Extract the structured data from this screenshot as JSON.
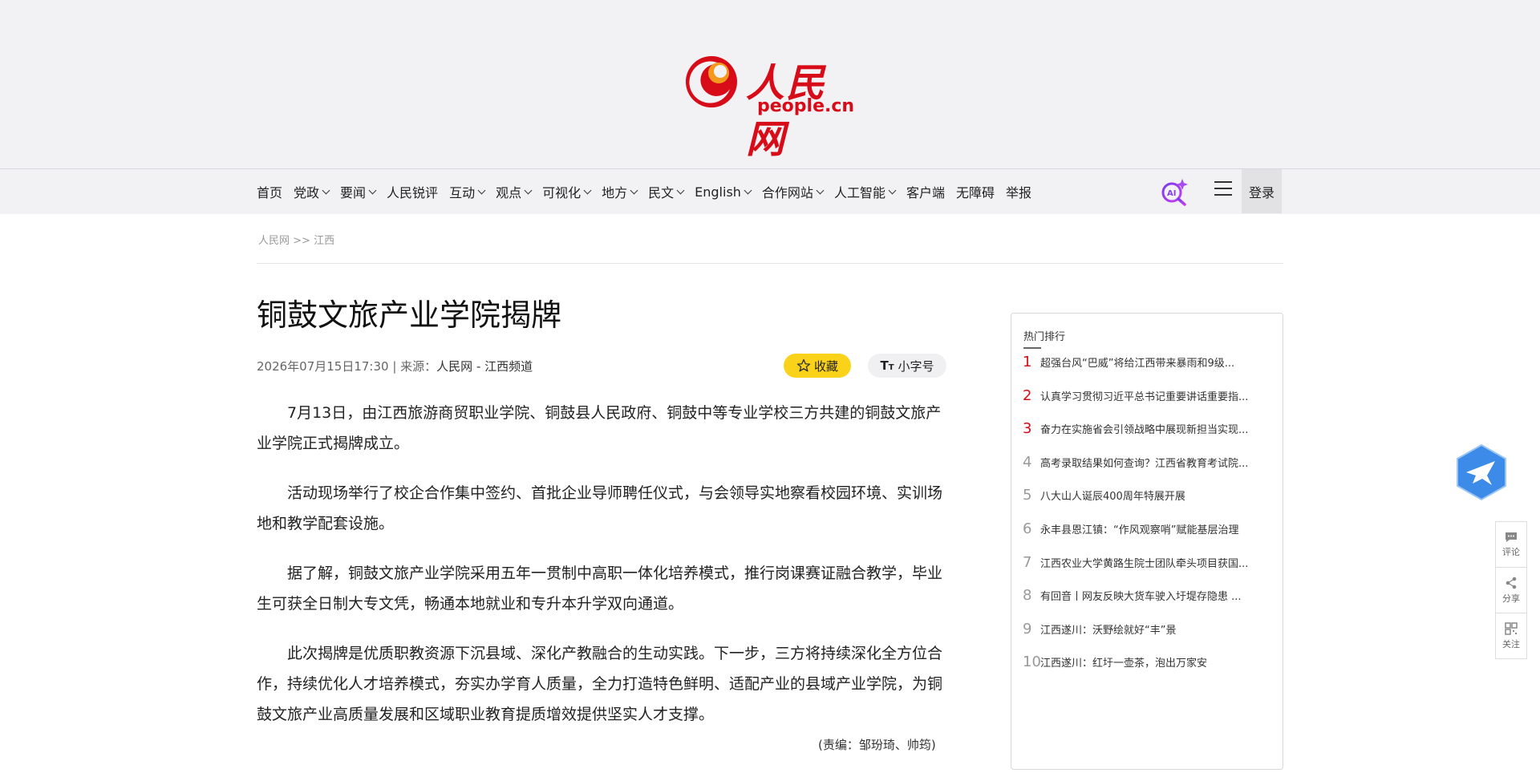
{
  "logo": {
    "cn": "人民网",
    "en": "people.cn"
  },
  "nav": {
    "items": [
      {
        "label": "首页",
        "dropdown": false
      },
      {
        "label": "党政",
        "dropdown": true
      },
      {
        "label": "要闻",
        "dropdown": true
      },
      {
        "label": "人民锐评",
        "dropdown": false
      },
      {
        "label": "互动",
        "dropdown": true
      },
      {
        "label": "观点",
        "dropdown": true
      },
      {
        "label": "可视化",
        "dropdown": true
      },
      {
        "label": "地方",
        "dropdown": true
      },
      {
        "label": "民文",
        "dropdown": true
      },
      {
        "label": "English",
        "dropdown": true
      },
      {
        "label": "合作网站",
        "dropdown": true
      },
      {
        "label": "人工智能",
        "dropdown": true
      },
      {
        "label": "客户端",
        "dropdown": false
      },
      {
        "label": "无障碍",
        "dropdown": false
      },
      {
        "label": "举报",
        "dropdown": false
      }
    ],
    "ai_icon": "ai-search-icon",
    "menu_icon": "hamburger-icon",
    "login": "登录"
  },
  "breadcrumb": {
    "home": "人民网",
    "sep": " >> ",
    "section": "江西"
  },
  "article": {
    "title": "铜鼓文旅产业学院揭牌",
    "date": "2026年07月15日17:30",
    "source_sep": " | 来源：",
    "source": "人民网 - 江西频道",
    "fav_label": "收藏",
    "size_label": "小字号",
    "paragraphs": [
      "7月13日，由江西旅游商贸职业学院、铜鼓县人民政府、铜鼓中等专业学校三方共建的铜鼓文旅产业学院正式揭牌成立。",
      "活动现场举行了校企合作集中签约、首批企业导师聘任仪式，与会领导实地察看校园环境、实训场地和教学配套设施。",
      "据了解，铜鼓文旅产业学院采用五年一贯制中高职一体化培养模式，推行岗课赛证融合教学，毕业生可获全日制大专文凭，畅通本地就业和专升本升学双向通道。",
      "此次揭牌是优质职教资源下沉县域、深化产教融合的生动实践。下一步，三方将持续深化全方位合作，持续优化人才培养模式，夯实办学育人质量，全力打造特色鲜明、适配产业的县域产业学院，为铜鼓文旅产业高质量发展和区域职业教育提质增效提供坚实人才支撑。"
    ],
    "editor": "(责编：邹玢琦、帅筠)"
  },
  "sidebar": {
    "title": "热门排行",
    "items": [
      {
        "rank": "1",
        "text": "超强台风“巴威”将给江西带来暴雨和9级..."
      },
      {
        "rank": "2",
        "text": "认真学习贯彻习近平总书记重要讲话重要指..."
      },
      {
        "rank": "3",
        "text": "奋力在实施省会引领战略中展现新担当实现..."
      },
      {
        "rank": "4",
        "text": "高考录取结果如何查询？江西省教育考试院..."
      },
      {
        "rank": "5",
        "text": "八大山人诞辰400周年特展开展"
      },
      {
        "rank": "6",
        "text": "永丰县恩江镇：“作风观察哨”赋能基层治理"
      },
      {
        "rank": "7",
        "text": "江西农业大学黄路生院士团队牵头项目获国..."
      },
      {
        "rank": "8",
        "text": "有回音丨网友反映大货车驶入圩堤存隐患 ..."
      },
      {
        "rank": "9",
        "text": "江西遂川：沃野绘就好“丰”景"
      },
      {
        "rank": "10",
        "text": "江西遂川：红圩一壶茶，泡出万家安"
      }
    ]
  },
  "toolbar": {
    "comment": "评论",
    "share": "分享",
    "follow": "关注"
  },
  "colors": {
    "brand_red": "#d80c18",
    "fav_yellow": "#fbd21a",
    "float_blue": "#3d8be8"
  }
}
